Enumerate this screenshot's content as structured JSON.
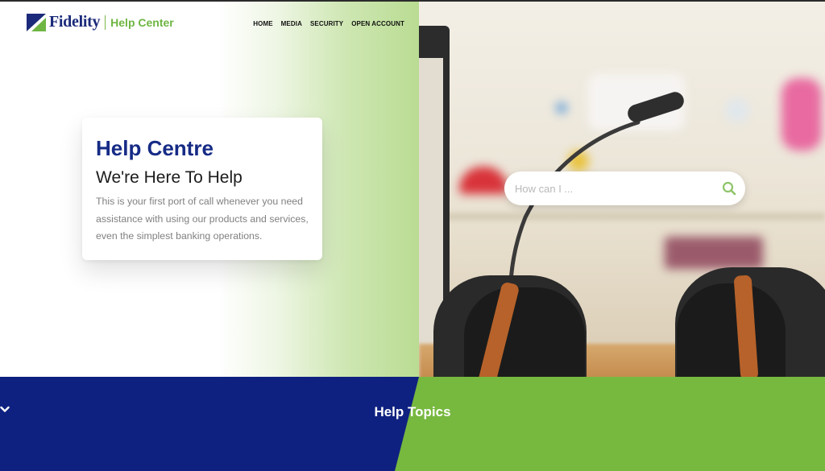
{
  "brand": {
    "name": "Fidelity",
    "section": "Help Center",
    "colors": {
      "navy": "#162b86",
      "green": "#6fb542"
    }
  },
  "nav": {
    "items": [
      {
        "label": "HOME"
      },
      {
        "label": "MEDIA"
      },
      {
        "label": "SECURITY"
      },
      {
        "label": "OPEN ACCOUNT"
      }
    ]
  },
  "hero": {
    "title": "Help Centre",
    "subtitle": "We're Here To Help",
    "description": "This is your first port of call whenever you need assistance with using our products and services, even the simplest banking operations."
  },
  "search": {
    "placeholder": "How can I ...",
    "value": "",
    "icon": "search-icon"
  },
  "topics": {
    "label": "Help Topics",
    "icon": "chevron-down-icon",
    "colors": {
      "left": "#0f2180",
      "right": "#77b83f"
    }
  }
}
